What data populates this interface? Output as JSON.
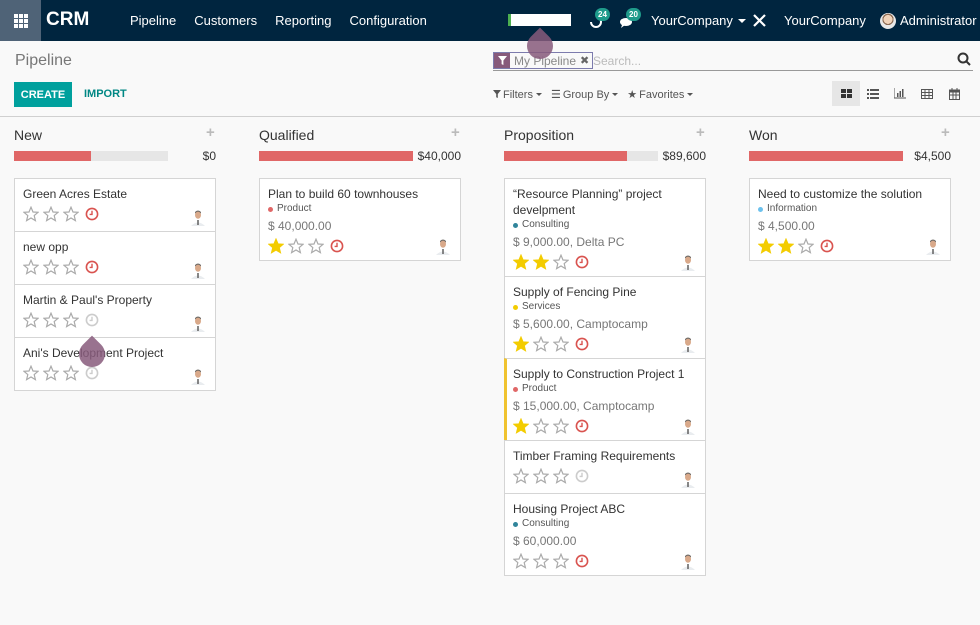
{
  "navbar": {
    "brand": "CRM",
    "menu": [
      "Pipeline",
      "Customers",
      "Reporting",
      "Configuration"
    ],
    "activities_count": "24",
    "messages_count": "20",
    "company_switcher": "YourCompany",
    "company_name": "YourCompany",
    "user_name": "Administrator",
    "icons": {
      "apps": "apps-grid-icon",
      "activities": "clock-activity-icon",
      "messages": "chat-bubbles-icon",
      "tools": "tools-icon"
    }
  },
  "control_panel": {
    "title": "Pipeline",
    "create_label": "CREATE",
    "import_label": "IMPORT",
    "search": {
      "facet_label": "My Pipeline",
      "placeholder": "Search..."
    },
    "filters_label": "Filters",
    "groupby_label": "Group By",
    "favorites_label": "Favorites",
    "views": [
      "kanban",
      "list",
      "graph",
      "pivot",
      "calendar"
    ],
    "active_view": "kanban"
  },
  "colors": {
    "navbar": "#00253f",
    "primary": "#00a09d",
    "accent": "#875a7b",
    "progress_red": "#e06767",
    "star_gold": "#f3cc00",
    "activity_overdue": "#d9534f"
  },
  "columns": [
    {
      "title": "New",
      "sum": "$0",
      "progress": 0.5,
      "cards": [
        {
          "title": "Green Acres Estate",
          "tag": "",
          "tag_color": "",
          "amount": "",
          "stars": 0,
          "activity": "overdue",
          "highlight": false
        },
        {
          "title": "new opp",
          "tag": "",
          "tag_color": "",
          "amount": "",
          "stars": 0,
          "activity": "overdue",
          "highlight": false
        },
        {
          "title": "Martin & Paul's Property",
          "tag": "",
          "tag_color": "",
          "amount": "",
          "stars": 0,
          "activity": "none",
          "highlight": false
        },
        {
          "title": "Ani's Development Project",
          "tag": "",
          "tag_color": "",
          "amount": "",
          "stars": 0,
          "activity": "none",
          "highlight": false
        }
      ]
    },
    {
      "title": "Qualified",
      "sum": "$40,000",
      "progress": 1.0,
      "cards": [
        {
          "title": "Plan to build 60 townhouses",
          "tag": "Product",
          "tag_color": "#e06767",
          "amount": "$ 40,000.00",
          "stars": 1,
          "activity": "overdue",
          "highlight": false
        }
      ]
    },
    {
      "title": "Proposition",
      "sum": "$89,600",
      "progress": 0.8,
      "cards": [
        {
          "title": "“Resource Planning” project develpment",
          "tag": "Consulting",
          "tag_color": "#30859b",
          "amount": "$ 9,000.00, Delta PC",
          "stars": 2,
          "activity": "overdue",
          "highlight": false
        },
        {
          "title": "Supply of Fencing Pine",
          "tag": "Services",
          "tag_color": "#f3cc00",
          "amount": "$ 5,600.00, Camptocamp",
          "stars": 1,
          "activity": "overdue",
          "highlight": false
        },
        {
          "title": "Supply to Construction Project 1",
          "tag": "Product",
          "tag_color": "#e06767",
          "amount": "$ 15,000.00, Camptocamp",
          "stars": 1,
          "activity": "overdue",
          "highlight": true
        },
        {
          "title": "Timber Framing Requirements",
          "tag": "",
          "tag_color": "",
          "amount": "",
          "stars": 0,
          "activity": "none",
          "highlight": false
        },
        {
          "title": "Housing Project ABC",
          "tag": "Consulting",
          "tag_color": "#30859b",
          "amount": "$ 60,000.00",
          "stars": 0,
          "activity": "overdue",
          "highlight": false
        }
      ]
    },
    {
      "title": "Won",
      "sum": "$4,500",
      "progress": 1.0,
      "cards": [
        {
          "title": "Need to customize the solution",
          "tag": "Information",
          "tag_color": "#6cc1ed",
          "amount": "$ 4,500.00",
          "stars": 2,
          "activity": "overdue",
          "highlight": false
        }
      ]
    }
  ]
}
